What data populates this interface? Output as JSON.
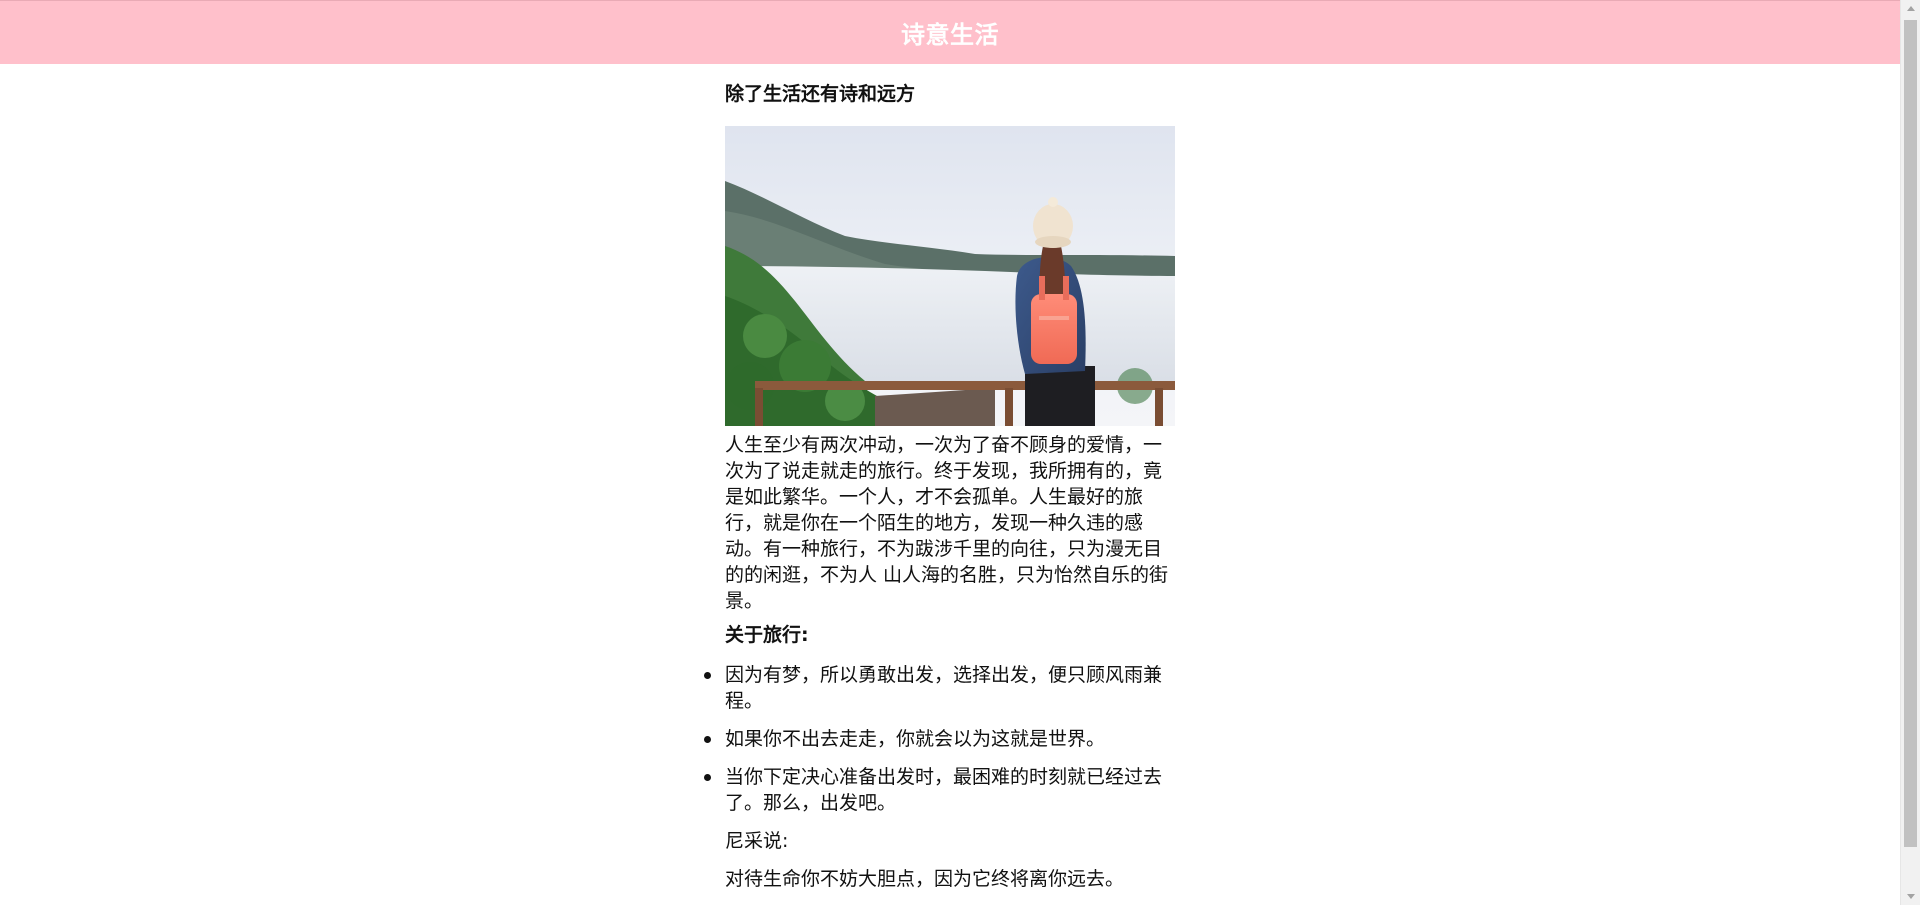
{
  "header": {
    "title": "诗意生活"
  },
  "article": {
    "heading": "除了生活还有诗和远方",
    "image_icon": "travel-photo",
    "paragraph": "人生至少有两次冲动，一次为了奋不顾身的爱情，一次为了说走就走的旅行。终于发现，我所拥有的，竟是如此繁华。一个人，才不会孤单。人生最好的旅行，就是你在一个陌生的地方，发现一种久违的感动。有一种旅行，不为跋涉千里的向往，只为漫无目的的闲逛，不为人 山人海的名胜，只为怡然自乐的街景。",
    "subheading": "关于旅行:",
    "bullets": [
      "因为有梦，所以勇敢出发，选择出发，便只顾风雨兼程。",
      "如果你不出去走走，你就会以为这就是世界。",
      "当你下定决心准备出发时，最困难的时刻就已经过去了。那么，出发吧。"
    ],
    "quote_intro": "尼采说:",
    "quote": "对待生命你不妨大胆点，因为它终将离你远去。"
  },
  "colors": {
    "header_bg": "#ffc0cb",
    "header_text": "#ffffff",
    "body_text": "#111111"
  }
}
